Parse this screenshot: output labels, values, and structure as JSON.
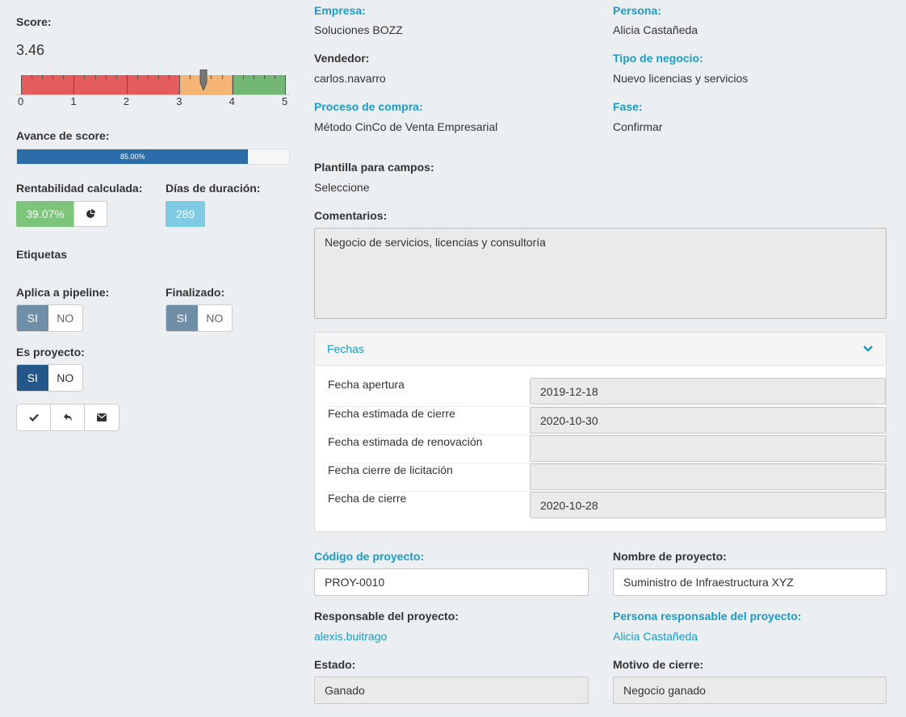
{
  "left": {
    "score_label": "Score:",
    "score_value": "3.46",
    "score_numeric": 3.46,
    "gauge_ticks": [
      "0",
      "1",
      "2",
      "3",
      "4",
      "5"
    ],
    "gauge_colors": {
      "low": "#e35d5d",
      "mid": "#f5b574",
      "high": "#72b774"
    },
    "progress_label": "Avance de score:",
    "progress_text": "85.00%",
    "progress_value": 0.85,
    "rentabilidad_label": "Rentabilidad calculada:",
    "rentabilidad_value": "39.07%",
    "chart_icon": "pie-chart-icon",
    "dias_label": "Días de duración:",
    "dias_value": "289",
    "etiquetas_label": "Etiquetas",
    "pipeline_label": "Aplica a pipeline:",
    "finalizado_label": "Finalizado:",
    "proyecto_label": "Es proyecto:",
    "si": "SI",
    "no": "NO",
    "actions": [
      "check-icon",
      "reply-icon",
      "envelope-icon"
    ]
  },
  "right": {
    "empresa_label": "Empresa:",
    "empresa_value": "Soluciones BOZZ",
    "persona_label": "Persona:",
    "persona_value": "Alicia Castañeda",
    "vendedor_label": "Vendedor:",
    "vendedor_value": "carlos.navarro",
    "tipo_label": "Tipo de negocio:",
    "tipo_value": "Nuevo licencias y servicios",
    "proceso_label": "Proceso de compra:",
    "proceso_value": "Método CinCo de Venta Empresarial",
    "fase_label": "Fase:",
    "fase_value": "Confirmar",
    "plantilla_label": "Plantilla para campos:",
    "plantilla_value": "Seleccione",
    "comentarios_label": "Comentarios:",
    "comentarios_value": "Negocio de servicios, licencias y consultoría"
  },
  "fechas": {
    "title": "Fechas",
    "rows": [
      {
        "label": "Fecha apertura",
        "value": "2019-12-18"
      },
      {
        "label": "Fecha estimada de cierre",
        "value": "2020-10-30"
      },
      {
        "label": "Fecha estimada de renovación",
        "value": ""
      },
      {
        "label": "Fecha cierre de licitación",
        "value": ""
      },
      {
        "label": "Fecha de cierre",
        "value": "2020-10-28"
      }
    ]
  },
  "proyecto": {
    "codigo_label": "Código de proyecto:",
    "codigo_value": "PROY-0010",
    "nombre_label": "Nombre de proyecto:",
    "nombre_value": "Suministro de Infraestructura XYZ",
    "responsable_label": "Responsable del proyecto:",
    "responsable_value": "alexis.buitrago",
    "persona_resp_label": "Persona responsable del proyecto:",
    "persona_resp_value": "Alicia Castañeda",
    "estado_label": "Estado:",
    "estado_value": "Ganado",
    "motivo_label": "Motivo de cierre:",
    "motivo_value": "Negocio ganado"
  }
}
